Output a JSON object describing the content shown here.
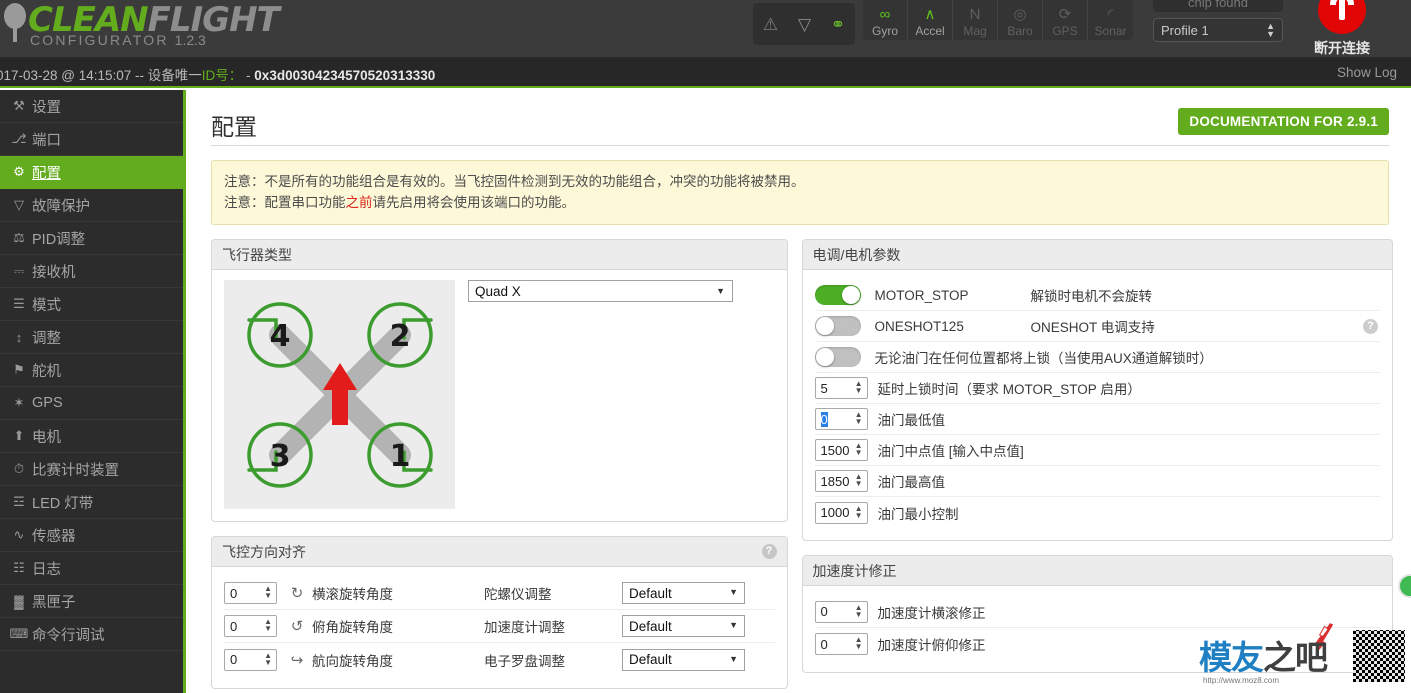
{
  "app": {
    "brand_clean": "CLEAN",
    "brand_flight": "FLIGHT",
    "subtitle": "CONFIGURATOR",
    "version": "1.2.3"
  },
  "header": {
    "status_icons": [
      {
        "name": "warning-icon",
        "glyph": "⚠"
      },
      {
        "name": "parachute-icon",
        "glyph": "▽"
      },
      {
        "name": "link-icon",
        "glyph": "⚭"
      }
    ],
    "sensors": [
      {
        "label": "Gyro",
        "glyph": "∞",
        "active": true
      },
      {
        "label": "Accel",
        "glyph": "∧",
        "active": true
      },
      {
        "label": "Mag",
        "glyph": "N",
        "active": false
      },
      {
        "label": "Baro",
        "glyph": "◎",
        "active": false
      },
      {
        "label": "GPS",
        "glyph": "⟳",
        "active": false
      },
      {
        "label": "Sonar",
        "glyph": "◜",
        "active": false
      }
    ],
    "chip_found": "chip found",
    "profile_selected": "Profile 1",
    "disconnect_label": "断开连接"
  },
  "infobar": {
    "text_start": "017-03-28 @ 14:15:07 -- 设备唯一",
    "text_green": "ID号：",
    "text_dash": " - ",
    "uid": "0x3d00304234570520313330",
    "show_log": "Show Log"
  },
  "sidebar": {
    "items": [
      {
        "label": "设置",
        "icon": "wrench-icon",
        "glyph": "⚒",
        "active": false
      },
      {
        "label": "端口",
        "icon": "plug-icon",
        "glyph": "⎇",
        "active": false
      },
      {
        "label": "配置",
        "icon": "gear-icon",
        "glyph": "⚙",
        "active": true
      },
      {
        "label": "故障保护",
        "icon": "parachute-icon",
        "glyph": "▽",
        "active": false
      },
      {
        "label": "PID调整",
        "icon": "sliders-icon",
        "glyph": "⚖",
        "active": false
      },
      {
        "label": "接收机",
        "icon": "receiver-icon",
        "glyph": "⎓",
        "active": false
      },
      {
        "label": "模式",
        "icon": "modes-icon",
        "glyph": "☰",
        "active": false
      },
      {
        "label": "调整",
        "icon": "adjust-icon",
        "glyph": "↕",
        "active": false
      },
      {
        "label": "舵机",
        "icon": "servo-icon",
        "glyph": "⚑",
        "active": false
      },
      {
        "label": "GPS",
        "icon": "satellite-icon",
        "glyph": "✶",
        "active": false
      },
      {
        "label": "电机",
        "icon": "motor-icon",
        "glyph": "⬆",
        "active": false
      },
      {
        "label": "比赛计时装置",
        "icon": "timer-icon",
        "glyph": "⏱",
        "active": false
      },
      {
        "label": "LED 灯带",
        "icon": "led-icon",
        "glyph": "☲",
        "active": false
      },
      {
        "label": "传感器",
        "icon": "sensor-icon",
        "glyph": "∿",
        "active": false
      },
      {
        "label": "日志",
        "icon": "log-icon",
        "glyph": "☷",
        "active": false
      },
      {
        "label": "黑匣子",
        "icon": "blackbox-icon",
        "glyph": "▓",
        "active": false
      },
      {
        "label": "命令行调试",
        "icon": "cli-icon",
        "glyph": "⌨",
        "active": false
      }
    ]
  },
  "page": {
    "title": "配置",
    "doc_button": "DOCUMENTATION FOR 2.9.1",
    "notes": [
      {
        "pre": "注意：不是所有的功能组合是有效的。当飞控固件检测到无效的功能组合，冲突的功能将被禁用。",
        "red": "",
        "post": ""
      },
      {
        "pre": "注意：配置串口功能",
        "red": "之前",
        "post": "请先启用将会使用该端口的功能。"
      }
    ]
  },
  "mixer_panel": {
    "title": "飞行器类型",
    "selected": "Quad X",
    "motors": [
      {
        "num": "4",
        "pos": "top-left"
      },
      {
        "num": "2",
        "pos": "top-right"
      },
      {
        "num": "3",
        "pos": "bottom-left"
      },
      {
        "num": "1",
        "pos": "bottom-right"
      }
    ],
    "arrow_color": "#e21b1b",
    "ring_color": "#3d9c2f"
  },
  "esc_panel": {
    "title": "电调/电机参数",
    "toggles": [
      {
        "name": "MOTOR_STOP",
        "desc": "解锁时电机不会旋转",
        "on": true,
        "help": false
      },
      {
        "name": "ONESHOT125",
        "desc": "ONESHOT 电调支持",
        "on": false,
        "help": true
      },
      {
        "name": "无论油门在任何位置都将上锁（当使用AUX通道解锁时）",
        "desc": "",
        "on": false,
        "help": false
      }
    ],
    "fields": [
      {
        "value": "5",
        "label": "延时上锁时间（要求 MOTOR_STOP 启用）",
        "selected": false
      },
      {
        "value": "0",
        "label": "油门最低值",
        "selected": true
      },
      {
        "value": "1500",
        "label": "油门中点值 [输入中点值]",
        "selected": false
      },
      {
        "value": "1850",
        "label": "油门最高值",
        "selected": false
      },
      {
        "value": "1000",
        "label": "油门最小控制",
        "selected": false
      }
    ]
  },
  "align_panel": {
    "title": "飞控方向对齐",
    "rows": [
      {
        "value": "0",
        "icon": "roll-rotate-icon",
        "glyph": "↻",
        "label": "横滚旋转角度",
        "center": "陀螺仪调整",
        "select": "Default"
      },
      {
        "value": "0",
        "icon": "pitch-rotate-icon",
        "glyph": "↺",
        "label": "俯角旋转角度",
        "center": "加速度计调整",
        "select": "Default"
      },
      {
        "value": "0",
        "icon": "yaw-rotate-icon",
        "glyph": "↪",
        "label": "航向旋转角度",
        "center": "电子罗盘调整",
        "select": "Default"
      }
    ]
  },
  "trim_panel": {
    "title": "加速度计修正",
    "rows": [
      {
        "value": "0",
        "label": "加速度计横滚修正"
      },
      {
        "value": "0",
        "label": "加速度计俯仰修正"
      }
    ]
  },
  "watermark": {
    "cn_blue": "模友",
    "cn_dark": "之吧",
    "url": "http://www.moz8.com"
  }
}
